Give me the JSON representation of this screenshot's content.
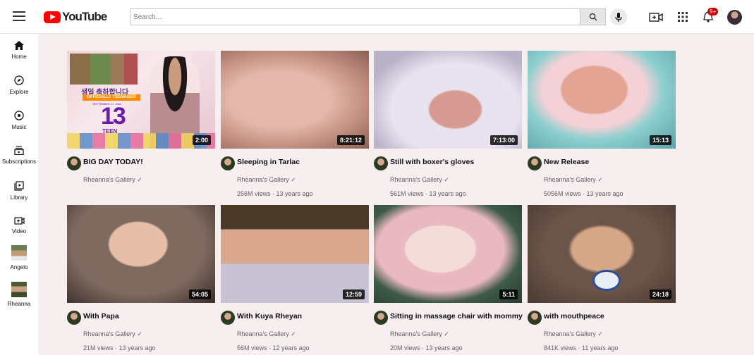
{
  "header": {
    "logo_text": "YouTube",
    "search_placeholder": "Search...",
    "notification_count": "9+"
  },
  "sidebar": {
    "items": [
      {
        "label": "Home",
        "icon": "home-icon"
      },
      {
        "label": "Explore",
        "icon": "compass-icon"
      },
      {
        "label": "Music",
        "icon": "music-disc-icon"
      },
      {
        "label": "Subscriptions",
        "icon": "subscriptions-icon"
      },
      {
        "label": "Library",
        "icon": "library-icon"
      },
      {
        "label": "Video",
        "icon": "video-upload-icon"
      },
      {
        "label": "Angelo",
        "icon": "avatar"
      },
      {
        "label": "Rheanna",
        "icon": "avatar"
      }
    ]
  },
  "videos": [
    {
      "title": "BIG DAY TODAY!",
      "duration": "2:00",
      "channel": "Rheanna's Gallery ✓",
      "views": "",
      "age": ""
    },
    {
      "title": "Sleeping in Tarlac",
      "duration": "8:21:12",
      "channel": "Rheanna's Gallery ✓",
      "views": "256M views",
      "age": "13 years ago"
    },
    {
      "title": "Still with boxer's gloves",
      "duration": "7:13:00",
      "channel": "Rheanna's Gallery ✓",
      "views": "561M views",
      "age": "13 years ago"
    },
    {
      "title": "New Release",
      "duration": "15:13",
      "channel": "Rheanna's Gallery ✓",
      "views": "5056M views",
      "age": "13 years ago"
    },
    {
      "title": "With Papa",
      "duration": "54:05",
      "channel": "Rheanna's Gallery ✓",
      "views": "21M views",
      "age": "13 years ago"
    },
    {
      "title": "With Kuya Rheyan",
      "duration": "12:59",
      "channel": "Rheanna's Gallery ✓",
      "views": "56M views",
      "age": "12 years ago"
    },
    {
      "title": "Sitting in massage chair with mommy",
      "duration": "5:11",
      "channel": "Rheanna's Gallery ✓",
      "views": "20M views",
      "age": "13 years ago"
    },
    {
      "title": "with mouthpeace",
      "duration": "24:18",
      "channel": "Rheanna's Gallery ✓",
      "views": "841K views",
      "age": "11 years ago"
    }
  ],
  "thumb1_text": {
    "korean": "생일 축하합니다",
    "banner": "OFFICIALLY TEENAGER",
    "date": "SEPTEMBER 17, 2022",
    "number": "13",
    "sub": "TEEN"
  }
}
